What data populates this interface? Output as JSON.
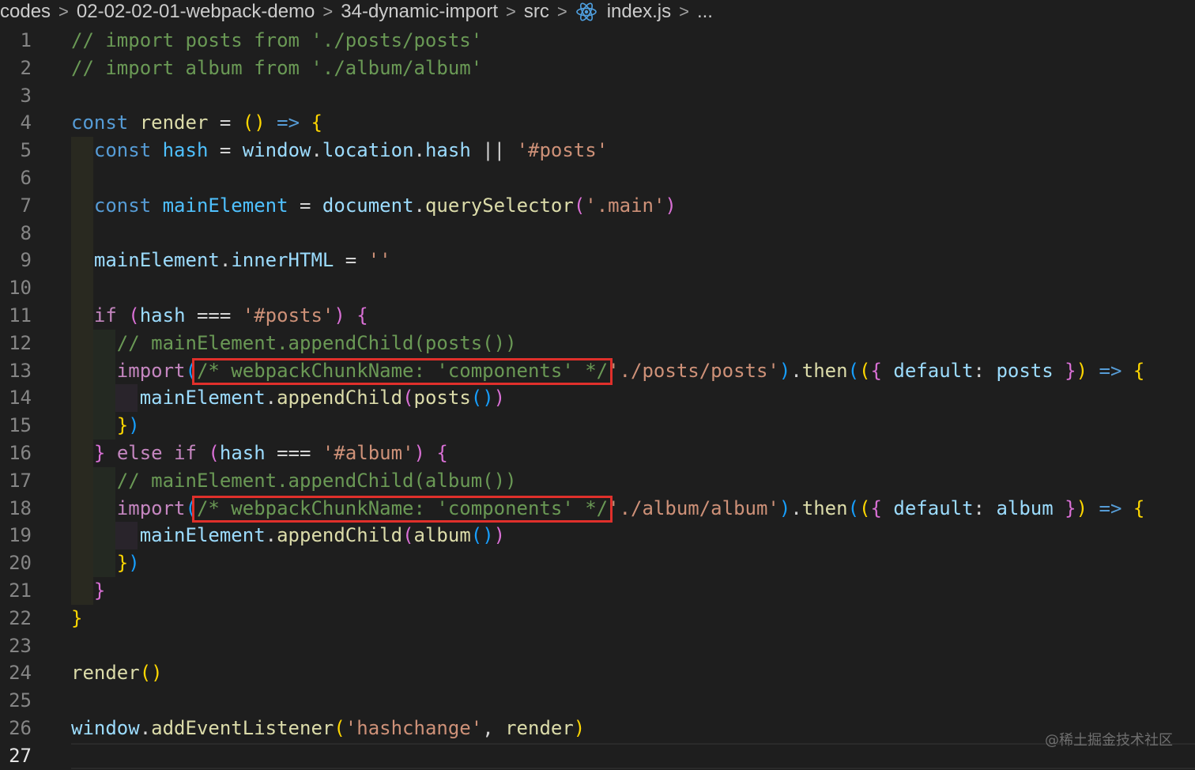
{
  "breadcrumb": {
    "items": [
      "codes",
      "02-02-02-01-webpack-demo",
      "34-dynamic-import",
      "src",
      "index.js",
      "..."
    ],
    "file_icon": "react-icon"
  },
  "editor": {
    "current_line": 27,
    "highlight_color": "#e0302b",
    "lines": [
      {
        "n": "1",
        "tokens": [
          [
            "c",
            "// import posts from './posts/posts'"
          ]
        ]
      },
      {
        "n": "2",
        "tokens": [
          [
            "c",
            "// import album from './album/album'"
          ]
        ]
      },
      {
        "n": "3",
        "tokens": []
      },
      {
        "n": "4",
        "tokens": [
          [
            "k",
            "const"
          ],
          [
            "p",
            " "
          ],
          [
            "f",
            "render"
          ],
          [
            "p",
            " = "
          ],
          [
            "b1",
            "()"
          ],
          [
            "p",
            " "
          ],
          [
            "a",
            "=>"
          ],
          [
            "p",
            " "
          ],
          [
            "b1",
            "{"
          ]
        ]
      },
      {
        "n": "5",
        "guides": 1,
        "tokens": [
          [
            "p",
            "  "
          ],
          [
            "k",
            "const"
          ],
          [
            "p",
            " "
          ],
          [
            "cst",
            "hash"
          ],
          [
            "p",
            " = "
          ],
          [
            "v",
            "window"
          ],
          [
            "p",
            "."
          ],
          [
            "v",
            "location"
          ],
          [
            "p",
            "."
          ],
          [
            "v",
            "hash"
          ],
          [
            "p",
            " || "
          ],
          [
            "s",
            "'#posts'"
          ]
        ]
      },
      {
        "n": "6",
        "guides": 1,
        "tokens": []
      },
      {
        "n": "7",
        "guides": 1,
        "tokens": [
          [
            "p",
            "  "
          ],
          [
            "k",
            "const"
          ],
          [
            "p",
            " "
          ],
          [
            "cst",
            "mainElement"
          ],
          [
            "p",
            " = "
          ],
          [
            "v",
            "document"
          ],
          [
            "p",
            "."
          ],
          [
            "f",
            "querySelector"
          ],
          [
            "b2",
            "("
          ],
          [
            "s",
            "'.main'"
          ],
          [
            "b2",
            ")"
          ]
        ]
      },
      {
        "n": "8",
        "guides": 1,
        "tokens": []
      },
      {
        "n": "9",
        "guides": 1,
        "tokens": [
          [
            "p",
            "  "
          ],
          [
            "v",
            "mainElement"
          ],
          [
            "p",
            "."
          ],
          [
            "v",
            "innerHTML"
          ],
          [
            "p",
            " = "
          ],
          [
            "s",
            "''"
          ]
        ]
      },
      {
        "n": "10",
        "guides": 1,
        "tokens": []
      },
      {
        "n": "11",
        "guides": 1,
        "tokens": [
          [
            "p",
            "  "
          ],
          [
            "ctl",
            "if"
          ],
          [
            "p",
            " "
          ],
          [
            "b2",
            "("
          ],
          [
            "v",
            "hash"
          ],
          [
            "p",
            " === "
          ],
          [
            "s",
            "'#posts'"
          ],
          [
            "b2",
            ")"
          ],
          [
            "p",
            " "
          ],
          [
            "b2",
            "{"
          ]
        ]
      },
      {
        "n": "12",
        "guides": 2,
        "tokens": [
          [
            "p",
            "    "
          ],
          [
            "c",
            "// mainElement.appendChild(posts())"
          ]
        ]
      },
      {
        "n": "13",
        "guides": 2,
        "box": 1,
        "tokens": [
          [
            "p",
            "    "
          ],
          [
            "ctl",
            "import"
          ],
          [
            "b3",
            "("
          ],
          [
            "c",
            "/* webpackChunkName: 'components' */"
          ],
          [
            "s",
            "'./posts/posts'"
          ],
          [
            "b3",
            ")"
          ],
          [
            "p",
            "."
          ],
          [
            "f",
            "then"
          ],
          [
            "b3",
            "("
          ],
          [
            "b1",
            "("
          ],
          [
            "b2",
            "{"
          ],
          [
            "p",
            " "
          ],
          [
            "v",
            "default"
          ],
          [
            "p",
            ": "
          ],
          [
            "v",
            "posts"
          ],
          [
            "p",
            " "
          ],
          [
            "b2",
            "}"
          ],
          [
            "b1",
            ")"
          ],
          [
            "p",
            " "
          ],
          [
            "a",
            "=>"
          ],
          [
            "p",
            " "
          ],
          [
            "b1",
            "{"
          ]
        ]
      },
      {
        "n": "14",
        "guides": 3,
        "tokens": [
          [
            "p",
            "      "
          ],
          [
            "v",
            "mainElement"
          ],
          [
            "p",
            "."
          ],
          [
            "f",
            "appendChild"
          ],
          [
            "b2",
            "("
          ],
          [
            "f",
            "posts"
          ],
          [
            "b3",
            "()"
          ],
          [
            "b2",
            ")"
          ]
        ]
      },
      {
        "n": "15",
        "guides": 2,
        "tokens": [
          [
            "p",
            "    "
          ],
          [
            "b1",
            "}"
          ],
          [
            "b3",
            ")"
          ]
        ]
      },
      {
        "n": "16",
        "guides": 1,
        "tokens": [
          [
            "p",
            "  "
          ],
          [
            "b2",
            "}"
          ],
          [
            "p",
            " "
          ],
          [
            "ctl",
            "else"
          ],
          [
            "p",
            " "
          ],
          [
            "ctl",
            "if"
          ],
          [
            "p",
            " "
          ],
          [
            "b2",
            "("
          ],
          [
            "v",
            "hash"
          ],
          [
            "p",
            " === "
          ],
          [
            "s",
            "'#album'"
          ],
          [
            "b2",
            ")"
          ],
          [
            "p",
            " "
          ],
          [
            "b2",
            "{"
          ]
        ]
      },
      {
        "n": "17",
        "guides": 2,
        "tokens": [
          [
            "p",
            "    "
          ],
          [
            "c",
            "// mainElement.appendChild(album())"
          ]
        ]
      },
      {
        "n": "18",
        "guides": 2,
        "box": 2,
        "tokens": [
          [
            "p",
            "    "
          ],
          [
            "ctl",
            "import"
          ],
          [
            "b3",
            "("
          ],
          [
            "c",
            "/* webpackChunkName: 'components' */"
          ],
          [
            "s",
            "'./album/album'"
          ],
          [
            "b3",
            ")"
          ],
          [
            "p",
            "."
          ],
          [
            "f",
            "then"
          ],
          [
            "b3",
            "("
          ],
          [
            "b1",
            "("
          ],
          [
            "b2",
            "{"
          ],
          [
            "p",
            " "
          ],
          [
            "v",
            "default"
          ],
          [
            "p",
            ": "
          ],
          [
            "v",
            "album"
          ],
          [
            "p",
            " "
          ],
          [
            "b2",
            "}"
          ],
          [
            "b1",
            ")"
          ],
          [
            "p",
            " "
          ],
          [
            "a",
            "=>"
          ],
          [
            "p",
            " "
          ],
          [
            "b1",
            "{"
          ]
        ]
      },
      {
        "n": "19",
        "guides": 3,
        "tokens": [
          [
            "p",
            "      "
          ],
          [
            "v",
            "mainElement"
          ],
          [
            "p",
            "."
          ],
          [
            "f",
            "appendChild"
          ],
          [
            "b2",
            "("
          ],
          [
            "f",
            "album"
          ],
          [
            "b3",
            "()"
          ],
          [
            "b2",
            ")"
          ]
        ]
      },
      {
        "n": "20",
        "guides": 2,
        "tokens": [
          [
            "p",
            "    "
          ],
          [
            "b1",
            "}"
          ],
          [
            "b3",
            ")"
          ]
        ]
      },
      {
        "n": "21",
        "guides": 1,
        "tokens": [
          [
            "p",
            "  "
          ],
          [
            "b2",
            "}"
          ]
        ]
      },
      {
        "n": "22",
        "tokens": [
          [
            "b1",
            "}"
          ]
        ]
      },
      {
        "n": "23",
        "tokens": []
      },
      {
        "n": "24",
        "tokens": [
          [
            "f",
            "render"
          ],
          [
            "b1",
            "()"
          ]
        ]
      },
      {
        "n": "25",
        "tokens": []
      },
      {
        "n": "26",
        "tokens": [
          [
            "v",
            "window"
          ],
          [
            "p",
            "."
          ],
          [
            "f",
            "addEventListener"
          ],
          [
            "b1",
            "("
          ],
          [
            "s",
            "'hashchange'"
          ],
          [
            "p",
            ", "
          ],
          [
            "f",
            "render"
          ],
          [
            "b1",
            ")"
          ]
        ]
      },
      {
        "n": "27",
        "tokens": []
      }
    ]
  },
  "watermark": "@稀土掘金技术社区"
}
